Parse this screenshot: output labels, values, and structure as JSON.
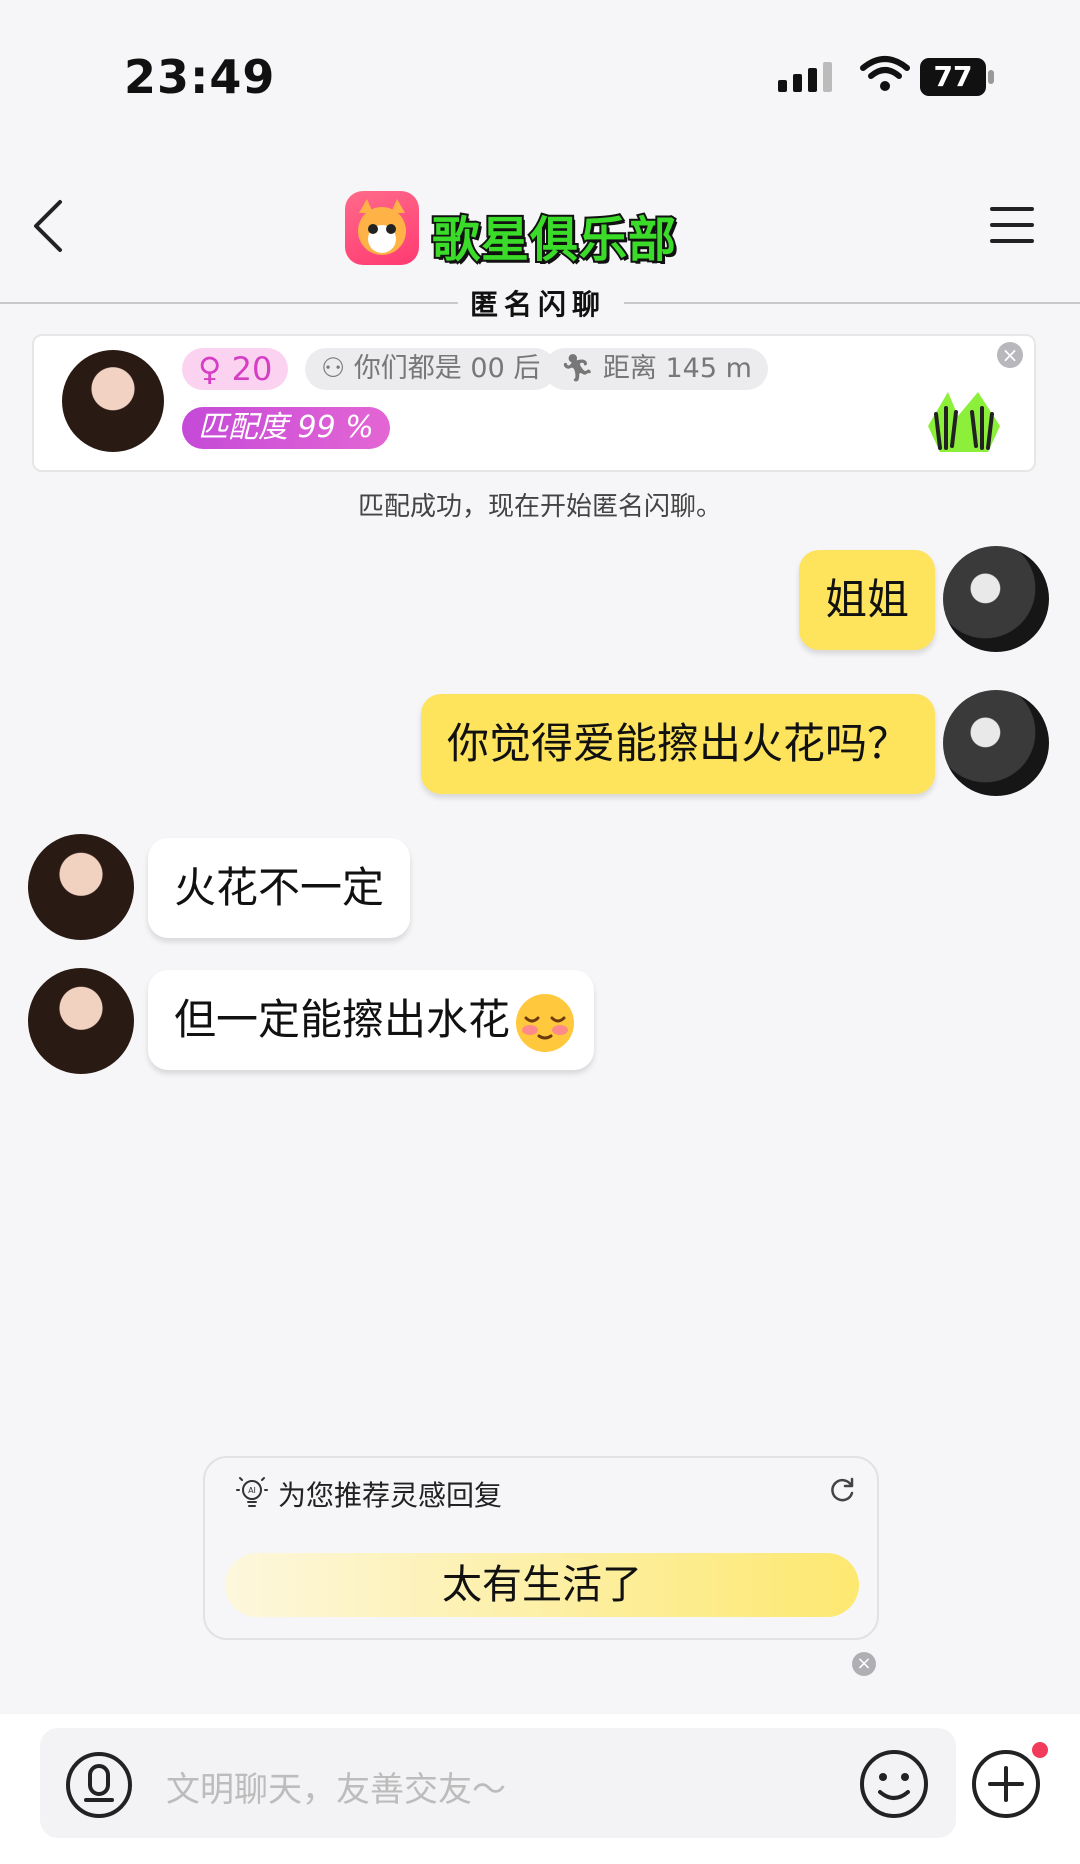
{
  "status_bar": {
    "time": "23:49",
    "battery": "77"
  },
  "header": {
    "brand": "歌星俱乐部",
    "subtitle": "匿名闪聊"
  },
  "match_card": {
    "age": "20",
    "generation_tag": "你们都是 00 后",
    "distance_tag": "距离 145 m",
    "match_score": "匹配度 99 %"
  },
  "system_message": "匹配成功，现在开始匿名闪聊。",
  "messages": [
    {
      "from": "me",
      "text": "姐姐"
    },
    {
      "from": "me",
      "text": "你觉得爱能擦出火花吗？"
    },
    {
      "from": "her",
      "text": "火花不一定"
    },
    {
      "from": "her",
      "text": "但一定能擦出水花"
    }
  ],
  "suggestion": {
    "title": "为您推荐灵感回复",
    "reply": "太有生活了"
  },
  "input": {
    "placeholder": "文明聊天，友善交友～"
  },
  "colors": {
    "my_bubble": "#fde45c",
    "accent_pink": "#d63ec4",
    "brand_green": "#3bdb2a"
  },
  "icons": [
    "back-arrow-icon",
    "menu-icon",
    "gender-female-icon",
    "people-icon",
    "running-icon",
    "high-five-icon",
    "ai-bulb-icon",
    "refresh-icon",
    "voice-icon",
    "emoji-icon",
    "plus-icon"
  ]
}
